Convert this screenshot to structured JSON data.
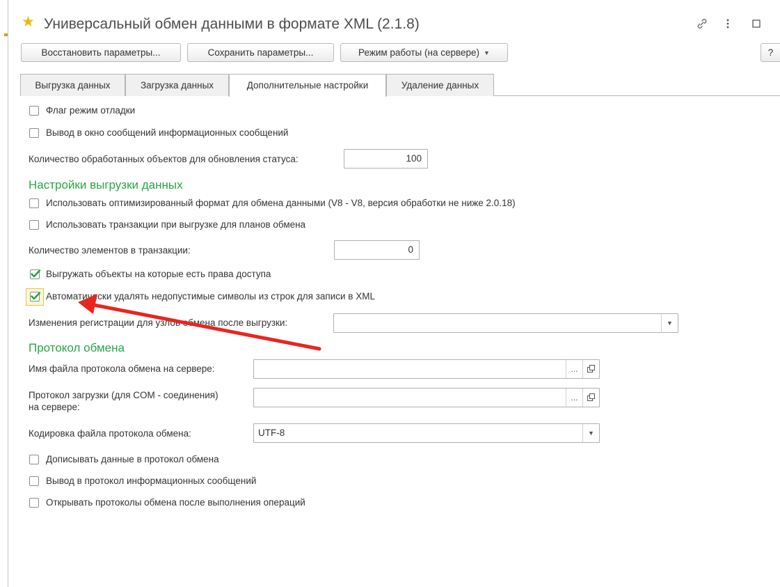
{
  "window": {
    "title": "Универсальный обмен данными в формате XML (2.1.8)",
    "accent_color": "#f2b705",
    "header_icons": [
      "link-icon",
      "more-vertical-icon",
      "maximize-icon"
    ]
  },
  "toolbar": {
    "restore_label": "Восстановить параметры...",
    "save_label": "Сохранить параметры...",
    "mode_label": "Режим работы (на сервере)",
    "help_label": "?"
  },
  "tabs": [
    {
      "label": "Выгрузка данных",
      "active": false
    },
    {
      "label": "Загрузка данных",
      "active": false
    },
    {
      "label": "Дополнительные настройки",
      "active": true
    },
    {
      "label": "Удаление данных",
      "active": false
    }
  ],
  "general": {
    "debug_flag": {
      "label": "Флаг режим отладки",
      "checked": false
    },
    "info_messages": {
      "label": "Вывод в окно сообщений информационных сообщений",
      "checked": false
    },
    "status_count_label": "Количество обработанных объектов для обновления статуса:",
    "status_count_value": "100"
  },
  "export_settings": {
    "title": "Настройки выгрузки данных",
    "section_color": "#28a745",
    "optimized_format": {
      "label": "Использовать оптимизированный формат для обмена данными (V8 - V8, версия обработки не ниже 2.0.18)",
      "checked": false
    },
    "use_transactions": {
      "label": "Использовать транзакции при выгрузке для планов обмена",
      "checked": false
    },
    "transaction_count_label": "Количество элементов в транзакции:",
    "transaction_count_value": "0",
    "access_rights": {
      "label": "Выгружать объекты на которые есть права доступа",
      "checked": true
    },
    "remove_invalid_chars": {
      "label": "Автоматически удалять недопустимые символы из строк для записи в XML",
      "checked": true
    },
    "registration_changes_label": "Изменения регистрации для узлов обмена после выгрузки:",
    "registration_changes_value": ""
  },
  "protocol": {
    "title": "Протокол обмена",
    "server_log_label": "Имя файла протокола обмена на сервере:",
    "server_log_value": "",
    "com_log_label_line1": "Протокол загрузки (для COM - соединения)",
    "com_log_label_line2": "на сервере:",
    "com_log_value": "",
    "encoding_label": "Кодировка файла протокола обмена:",
    "encoding_value": "UTF-8",
    "append_data": {
      "label": "Дописывать данные в протокол обмена",
      "checked": false
    },
    "info_to_protocol": {
      "label": "Вывод в протокол информационных сообщений",
      "checked": false
    },
    "open_protocols": {
      "label": "Открывать протоколы обмена после выполнения операций",
      "checked": false
    },
    "select_button": "...",
    "open_button_icon": "open-icon"
  },
  "annotation": {
    "arrow_color": "#e8261e"
  }
}
